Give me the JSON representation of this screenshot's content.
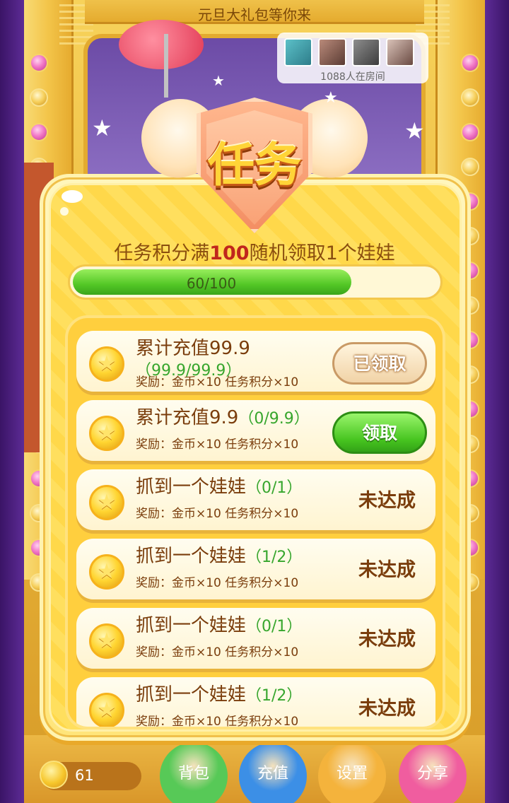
{
  "background": {
    "banner_text": "元旦大礼包等你来",
    "viewer_count_text": "1088人在房间",
    "coins_value": "61",
    "bottom_buttons": [
      "背包",
      "充值",
      "设置",
      "分享"
    ],
    "bottom_button_colors": [
      "#57c957",
      "#3c8fe6",
      "#f4b33c",
      "#f05d9f"
    ]
  },
  "dialog": {
    "title": "任务",
    "subtitle_prefix": "任务积分满",
    "subtitle_highlight": "100",
    "subtitle_suffix": "随机领取1个娃娃",
    "progress": {
      "label": "60/100",
      "fraction": 0.6
    }
  },
  "tasks": [
    {
      "title": "累计充值99.9",
      "progress": "（99.9/99.9）",
      "reward": "奖励：金币×10 任务积分×10",
      "action": "已领取",
      "state": "done"
    },
    {
      "title": "累计充值9.9",
      "progress": "（0/9.9）",
      "reward": "奖励：金币×10 任务积分×10",
      "action": "领取",
      "state": "claim"
    },
    {
      "title": "抓到一个娃娃",
      "progress": "（0/1）",
      "reward": "奖励：金币×10 任务积分×10",
      "action": "未达成",
      "state": "pending"
    },
    {
      "title": "抓到一个娃娃",
      "progress": "（1/2）",
      "reward": "奖励：金币×10 任务积分×10",
      "action": "未达成",
      "state": "pending"
    },
    {
      "title": "抓到一个娃娃",
      "progress": "（0/1）",
      "reward": "奖励：金币×10 任务积分×10",
      "action": "未达成",
      "state": "pending"
    },
    {
      "title": "抓到一个娃娃",
      "progress": "（1/2）",
      "reward": "奖励：金币×10 任务积分×10",
      "action": "未达成",
      "state": "pending"
    }
  ],
  "colors": {
    "progress_green": "#53c726",
    "task_text": "#7a3d0c",
    "progress_text_green": "#37a62d",
    "highlight_red": "#c0261d"
  }
}
